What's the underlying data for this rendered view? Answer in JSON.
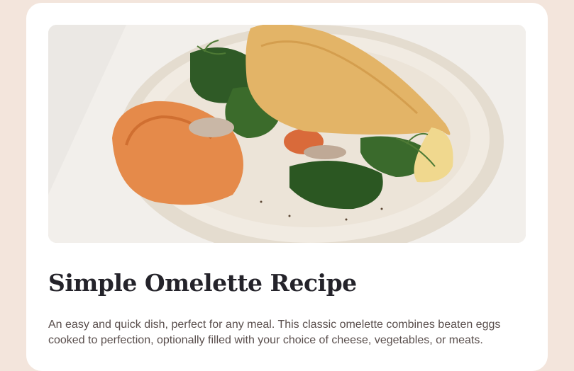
{
  "recipe": {
    "hero_image": "omelette-on-plate-photo",
    "title": "Simple Omelette Recipe",
    "description": "An easy and quick dish, perfect for any meal. This classic omelette combines beaten eggs cooked to perfection, optionally filled with your choice of cheese, vegetables, or meats."
  },
  "colors": {
    "page_background": "#f3e5dc",
    "card_background": "#ffffff",
    "title": "#24232a",
    "body_text": "#5a4f4d"
  }
}
